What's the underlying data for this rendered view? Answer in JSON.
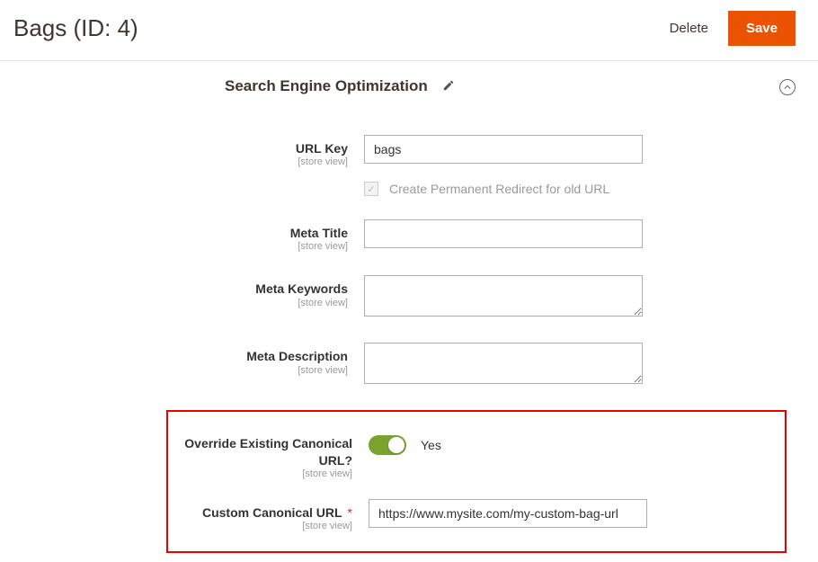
{
  "header": {
    "title": "Bags (ID: 4)",
    "delete_label": "Delete",
    "save_label": "Save"
  },
  "section": {
    "title": "Search Engine Optimization"
  },
  "scope_label": "[store view]",
  "fields": {
    "url_key": {
      "label": "URL Key",
      "value": "bags"
    },
    "redirect": {
      "label": "Create Permanent Redirect for old URL",
      "checked": true
    },
    "meta_title": {
      "label": "Meta Title",
      "value": ""
    },
    "meta_keywords": {
      "label": "Meta Keywords",
      "value": ""
    },
    "meta_description": {
      "label": "Meta Description",
      "value": ""
    },
    "override_canonical": {
      "label": "Override Existing Canonical URL?",
      "value_label": "Yes"
    },
    "custom_canonical": {
      "label": "Custom Canonical URL",
      "value": "https://www.mysite.com/my-custom-bag-url"
    }
  }
}
